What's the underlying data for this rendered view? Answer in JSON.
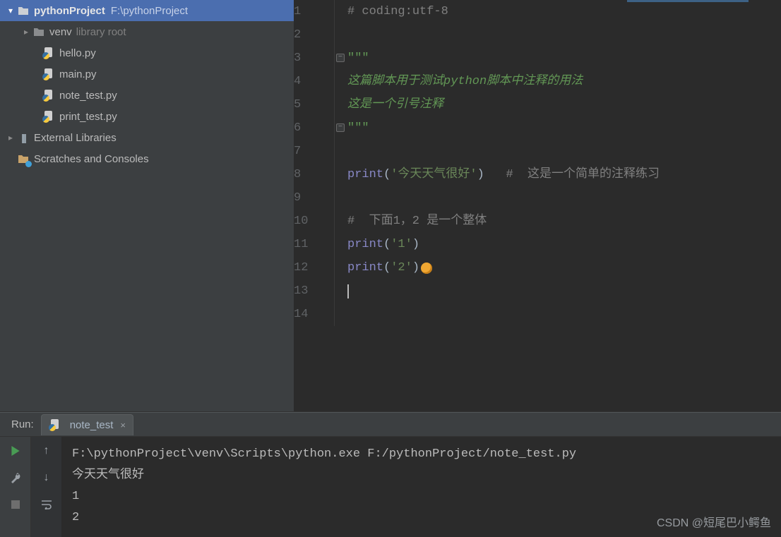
{
  "project_tree": {
    "root_name": "pythonProject",
    "root_path": "F:\\pythonProject",
    "venv_name": "venv",
    "venv_hint": "library root",
    "files": [
      "hello.py",
      "main.py",
      "note_test.py",
      "print_test.py"
    ],
    "external_libs": "External Libraries",
    "scratches": "Scratches and Consoles"
  },
  "editor": {
    "lines": {
      "l1": "# coding:utf-8",
      "l3": "\"\"\"",
      "l4": "这篇脚本用于测试python脚本中注释的用法",
      "l5": "这是一个引号注释",
      "l6": "\"\"\"",
      "l8_a": "print",
      "l8_b": "'今天天气很好'",
      "l8_c": "#  这是一个简单的注释练习",
      "l10": "#  下面1，2 是一个整体",
      "l11_a": "print",
      "l11_b": "'1'",
      "l12_a": "print",
      "l12_b": "'2'"
    },
    "line_numbers": [
      "1",
      "2",
      "3",
      "4",
      "5",
      "6",
      "7",
      "8",
      "9",
      "10",
      "11",
      "12",
      "13",
      "14"
    ]
  },
  "run": {
    "label": "Run:",
    "tab_name": "note_test",
    "console_lines": [
      "F:\\pythonProject\\venv\\Scripts\\python.exe F:/pythonProject/note_test.py",
      "今天天气很好",
      "1",
      "2"
    ]
  },
  "watermark": "CSDN @短尾巴小鳄鱼"
}
